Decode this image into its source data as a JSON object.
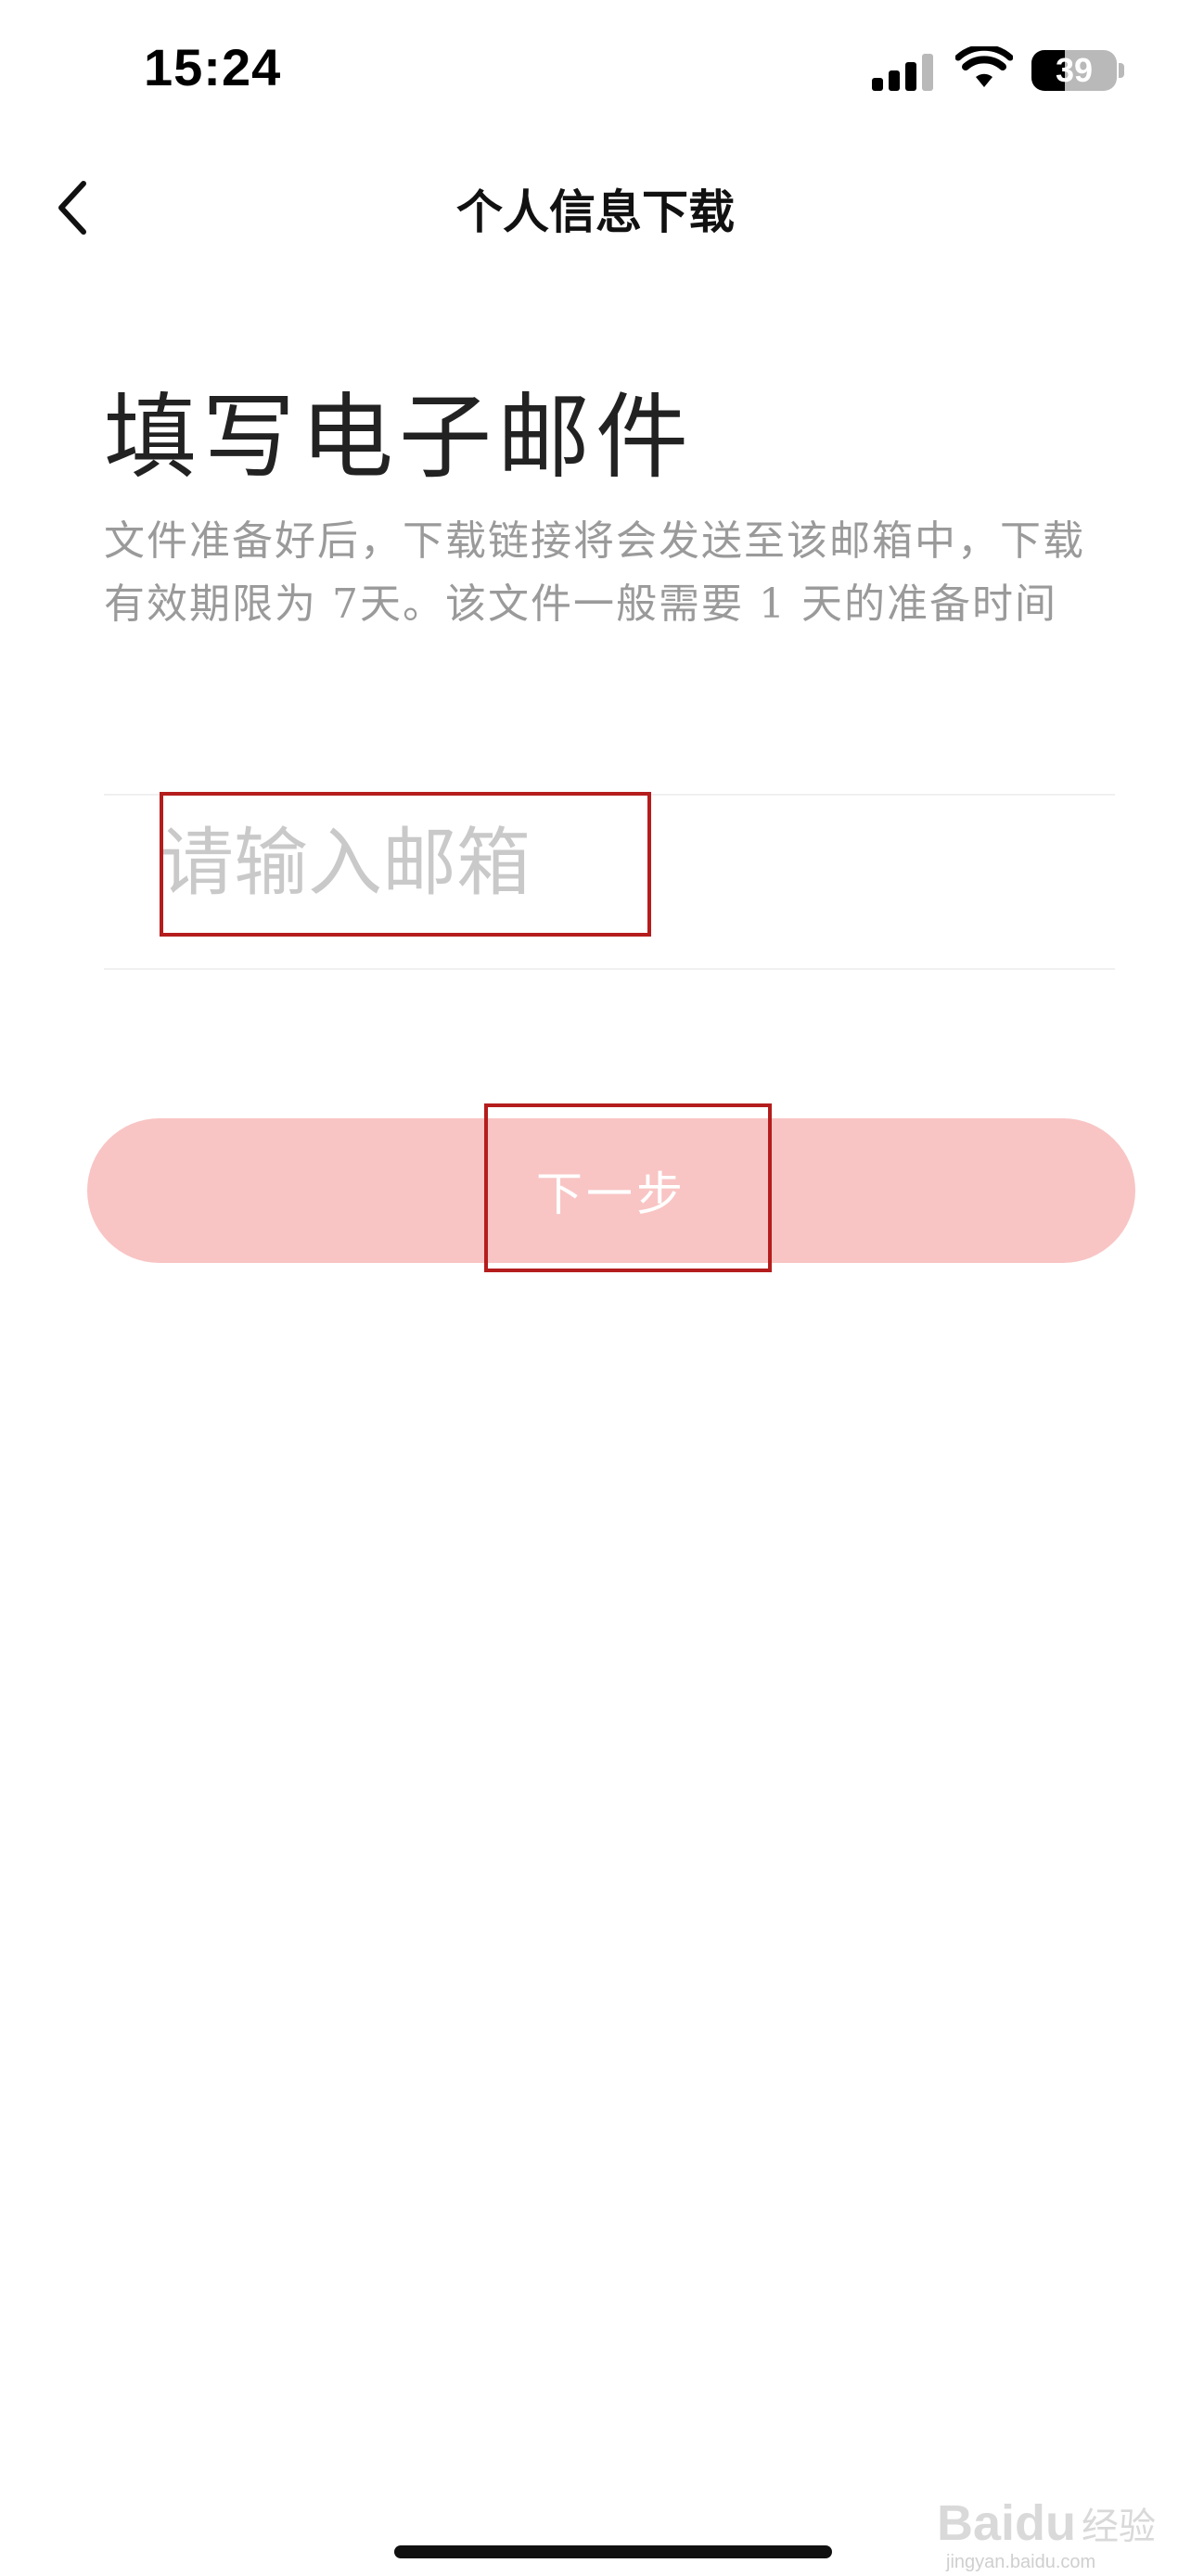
{
  "status_bar": {
    "time": "15:24",
    "battery_level": "39"
  },
  "nav": {
    "title": "个人信息下载"
  },
  "page": {
    "heading": "填写电子邮件",
    "description": "文件准备好后，下载链接将会发送至该邮箱中，下载有效期限为 7天。该文件一般需要 1 天的准备时间"
  },
  "email_field": {
    "placeholder": "请输入邮箱",
    "value": ""
  },
  "next_button": {
    "label": "下一步",
    "color": "#f8c5c4"
  },
  "annotation_color": "#b51d1d",
  "watermark": {
    "brand": "Baidu",
    "sub": "经验",
    "domain": "jingyan.baidu.com"
  }
}
